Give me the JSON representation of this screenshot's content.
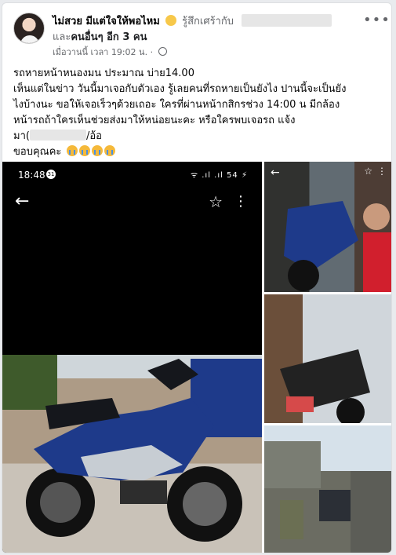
{
  "post": {
    "author": "ไม่สวย มีแต่ใจให้พอไหม",
    "feeling": "รู้สึกเศร้ากับ",
    "tagged_others": "และ",
    "others_count": "คนอื่นๆ อีก 3 คน",
    "timestamp": "เมื่อวานนี้ เวลา 19:02 น. ·",
    "more_label": "•••",
    "text_lines": [
      "รถหายหน้าหนองมน ประมาณ บ่าย14.00",
      "เห็นแต่ในข่าว วันนี้มาเจอกับตัวเอง รู้เลยคนที่รถหายเป็นยังไง ปานนี้จะเป็นยัง",
      "ไงบ้างนะ ขอให้เจอเร็วๆด้วยเถอะ ใครที่ผ่านหน้ากสิกรช่วง 14:00 น มีกล้อง",
      "หน้ารถถ้าใครเห็นช่วยส่งมาให้หน่อยนะคะ หรือใครพบเจอรถ แจ้ง"
    ],
    "contact_prefix": "มา(",
    "contact_suffix": "/อ้อ",
    "thanks": "ขอบคุณคะ"
  },
  "photo_main": {
    "status_time": "18:48",
    "status_badge": "31",
    "status_icons": "ᯤ .ıl .ıl 54 ⚡",
    "back_icon": "←",
    "star_icon": "☆",
    "kebab_icon": "⋮"
  },
  "photo_side_1": {
    "back_icon": "←",
    "star_icon": "☆",
    "kebab_icon": "⋮"
  },
  "colors": {
    "bike_blue": "#1e3a8a",
    "bike_silver": "#c7cdd3"
  }
}
